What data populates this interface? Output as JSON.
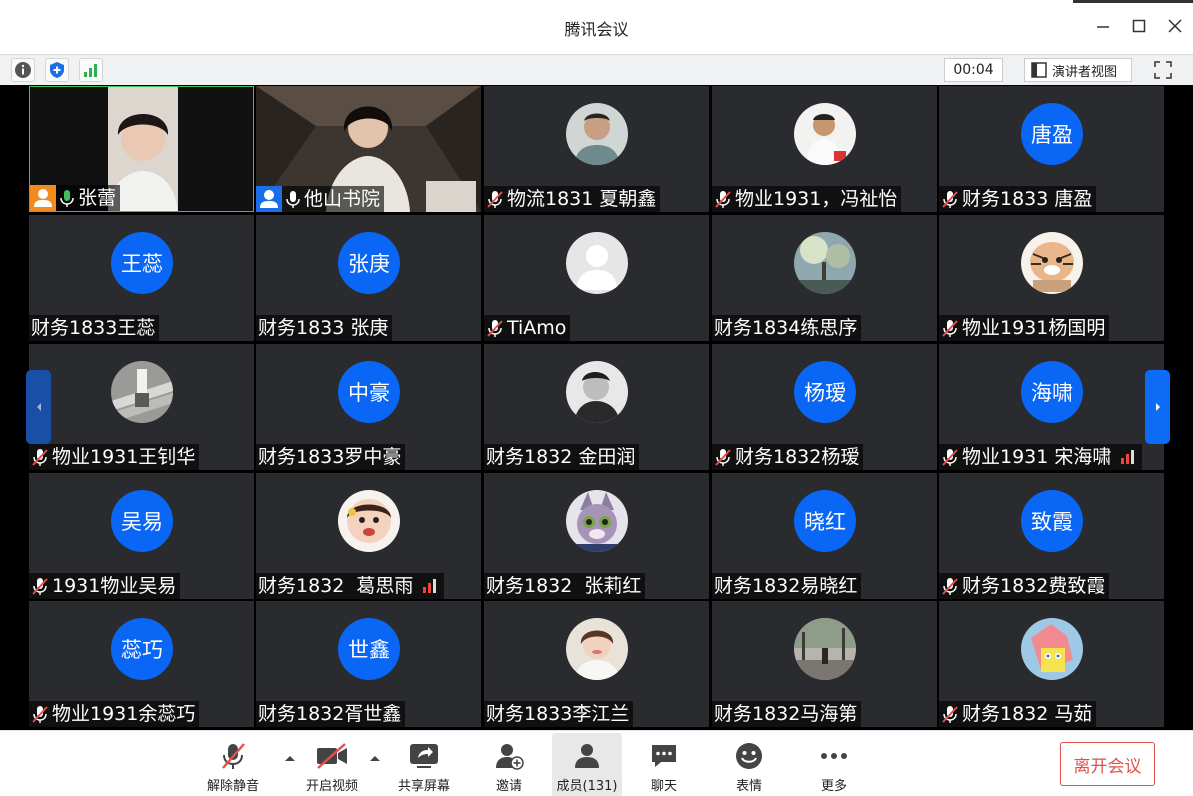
{
  "window": {
    "title": "腾讯会议"
  },
  "infobar": {
    "timer": "00:04",
    "view_label": "演讲者视图"
  },
  "participants": [
    {
      "name": "张蕾",
      "avatar": "video",
      "muted": false
    },
    {
      "name": "他山书院",
      "avatar": "video",
      "muted": false
    },
    {
      "name": "物流1831 夏朝鑫",
      "avatar": "photo-man",
      "muted": true
    },
    {
      "name": "物业1931，冯祉怡",
      "avatar": "photo-boy",
      "muted": true
    },
    {
      "name": "财务1833 唐盈",
      "avatar": "text",
      "avatar_text": "唐盈",
      "muted": true
    },
    {
      "name": "财务1833王蕊",
      "avatar": "text",
      "avatar_text": "王蕊",
      "muted": false
    },
    {
      "name": "财务1833 张庚",
      "avatar": "text",
      "avatar_text": "张庚",
      "muted": false
    },
    {
      "name": "TiAmo",
      "avatar": "photo-default",
      "muted": true
    },
    {
      "name": "财务1834练思序",
      "avatar": "photo-tree",
      "muted": false
    },
    {
      "name": "物业1931杨国明",
      "avatar": "photo-tiger",
      "muted": true
    },
    {
      "name": "物业1931王钊华",
      "avatar": "photo-stairs",
      "muted": true
    },
    {
      "name": "财务1833罗中豪",
      "avatar": "text",
      "avatar_text": "中豪",
      "muted": false
    },
    {
      "name": "财务1832 金田润",
      "avatar": "photo-bw",
      "muted": false
    },
    {
      "name": "财务1832杨瑷",
      "avatar": "text",
      "avatar_text": "杨瑷",
      "muted": true
    },
    {
      "name": "物业1931 宋海啸",
      "avatar": "text",
      "avatar_text": "海啸",
      "muted": true,
      "signal": true
    },
    {
      "name": "1931物业吴易",
      "avatar": "text",
      "avatar_text": "吴易",
      "muted": true
    },
    {
      "name": "财务1832  葛思雨",
      "avatar": "photo-girl",
      "muted": false,
      "signal": true
    },
    {
      "name": "财务1832  张莉红",
      "avatar": "photo-bunny",
      "muted": false
    },
    {
      "name": "财务1832易晓红",
      "avatar": "text",
      "avatar_text": "晓红",
      "muted": false
    },
    {
      "name": "财务1832费致霞",
      "avatar": "text",
      "avatar_text": "致霞",
      "muted": true
    },
    {
      "name": "物业1931余蕊巧",
      "avatar": "text",
      "avatar_text": "蕊巧",
      "muted": true
    },
    {
      "name": "财务1832胥世鑫",
      "avatar": "text",
      "avatar_text": "世鑫",
      "muted": false
    },
    {
      "name": "财务1833李江兰",
      "avatar": "photo-woman",
      "muted": false
    },
    {
      "name": "财务1832马海第",
      "avatar": "photo-street",
      "muted": false
    },
    {
      "name": "财务1832 马茹",
      "avatar": "photo-cartoon",
      "muted": true
    }
  ],
  "toolbar": {
    "unmute": "解除静音",
    "start_video": "开启视频",
    "share_screen": "共享屏幕",
    "invite": "邀请",
    "members": "成员(131)",
    "chat": "聊天",
    "reactions": "表情",
    "more": "更多",
    "leave": "离开会议"
  },
  "colors": {
    "accent": "#0a66f5",
    "leave": "#e0504c",
    "active_speaker": "#3fbf5f"
  }
}
